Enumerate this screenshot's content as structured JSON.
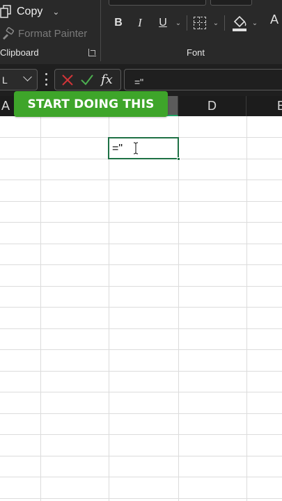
{
  "ribbon": {
    "clipboard": {
      "copy_label": "Copy",
      "format_painter_label": "Format Painter",
      "group_label": "Clipboard"
    },
    "font": {
      "group_label": "Font",
      "bold_label": "B",
      "italic_label": "I",
      "underline_label": "U",
      "font_color_label": "A"
    }
  },
  "formula_bar": {
    "name_box_value": "L",
    "fx_label": "fx",
    "formula_value": "=\""
  },
  "columns": [
    {
      "label": "A",
      "active": false
    },
    {
      "label": "",
      "active": false
    },
    {
      "label": "",
      "active": true
    },
    {
      "label": "D",
      "active": false
    },
    {
      "label": "E",
      "active": false
    }
  ],
  "active_cell": {
    "content": "=\""
  },
  "overlay": {
    "banner_text": "START DOING THIS"
  },
  "colors": {
    "ribbon_bg": "#292929",
    "selection_green": "#1e7145",
    "banner_green": "#3ea52a",
    "cancel_red": "#d13438",
    "enter_green": "#4caf50"
  }
}
